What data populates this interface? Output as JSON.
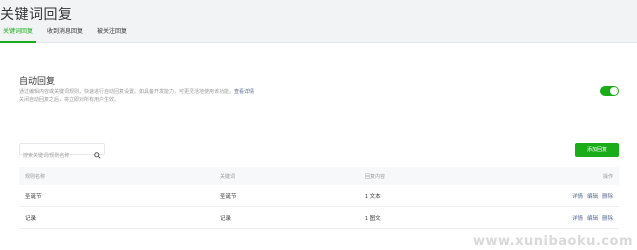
{
  "header": {
    "title": "关键词回复"
  },
  "tabs": [
    {
      "label": "关键词回复",
      "active": true
    },
    {
      "label": "收到消息回复",
      "active": false
    },
    {
      "label": "被关注回复",
      "active": false
    }
  ],
  "auto_reply": {
    "title": "自动回复",
    "description": "通过编辑内容或关键词规则，快速进行自动回复设置。如具备开发能力，可更灵活地使用该功能。",
    "link_text": "查看详情",
    "description_2": "关闭自动回复之后，将立即对所有用户生效。",
    "enabled": true
  },
  "search": {
    "placeholder": "搜索关键词/规则名称"
  },
  "add_button": {
    "label": "添加回复"
  },
  "table": {
    "headers": [
      "规则名称",
      "关键词",
      "回复内容",
      "操作"
    ],
    "rows": [
      {
        "name": "圣诞节",
        "keyword": "圣诞节",
        "content": "1 文本",
        "ops": [
          "详情",
          "编辑",
          "删除"
        ]
      },
      {
        "name": "记录",
        "keyword": "记录",
        "content": "1 图文",
        "ops": [
          "详情",
          "编辑",
          "删除"
        ]
      }
    ]
  },
  "watermark": "www.xunibaoku.com",
  "colors": {
    "accent": "#1aad19",
    "link": "#576b95"
  }
}
